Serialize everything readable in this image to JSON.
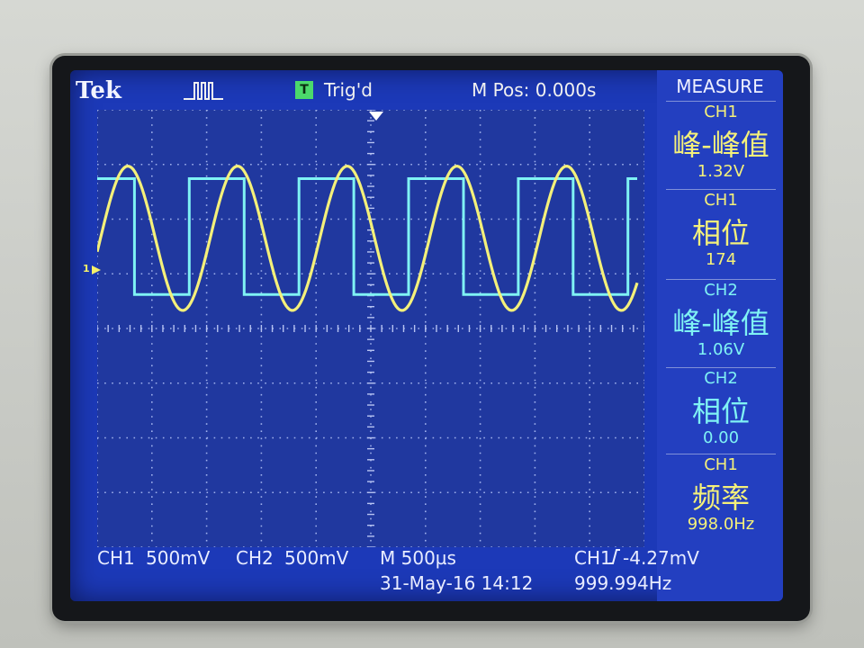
{
  "header": {
    "brand": "Tek",
    "acq_icon": "pulse-waveform-icon",
    "trigger_status_icon_letter": "T",
    "trigger_status": "Trig'd",
    "m_pos": "M Pos: 0.000s"
  },
  "menu": {
    "title": "MEASURE",
    "measurements": [
      {
        "channel": "CH1",
        "name": "峰-峰值",
        "value": "1.32V",
        "color": "#f4f07a"
      },
      {
        "channel": "CH1",
        "name": "相位",
        "value": "174",
        "color": "#f4f07a"
      },
      {
        "channel": "CH2",
        "name": "峰-峰值",
        "value": "1.06V",
        "color": "#7ff2f4"
      },
      {
        "channel": "CH2",
        "name": "相位",
        "value": "0.00",
        "color": "#7ff2f4"
      },
      {
        "channel": "CH1",
        "name": "频率",
        "value": "998.0Hz",
        "color": "#f4f07a"
      }
    ]
  },
  "status": {
    "ch1_label": "CH1",
    "ch1_scale": "500mV",
    "ch2_label": "CH2",
    "ch2_scale": "500mV",
    "timebase": "M 500µs",
    "date_time": "31-May-16 14:12",
    "trigger_source": "CH1",
    "trigger_level": "-4.27mV",
    "trigger_freq": "999.994Hz"
  },
  "markers": {
    "ch1_ground": "1"
  },
  "colors": {
    "screen_bg": "#1c39b8",
    "ch1_trace": "#f4f07a",
    "ch2_trace": "#7ff2f4",
    "trigger_badge": "#4bd96b"
  }
}
